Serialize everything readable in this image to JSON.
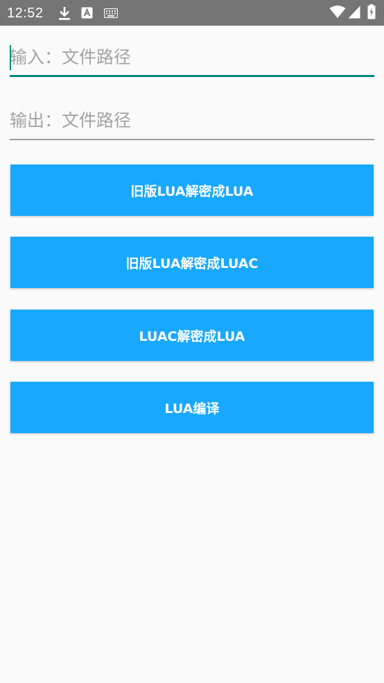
{
  "status_bar": {
    "time": "12:52",
    "left_icons": [
      "download-icon",
      "a-notification-icon",
      "keyboard-icon"
    ],
    "right_icons": [
      "wifi-icon",
      "signal-icon",
      "battery-icon"
    ],
    "background": "#757575"
  },
  "input_field": {
    "placeholder": "输入：文件路径",
    "value": "",
    "focused": true,
    "accent": "#00897b"
  },
  "output_field": {
    "placeholder": "输出：文件路径",
    "value": ""
  },
  "buttons": [
    {
      "label": "旧版LUA解密成LUA"
    },
    {
      "label": "旧版LUA解密成LUAC"
    },
    {
      "label": "LUAC解密成LUA"
    },
    {
      "label": "LUA编译"
    }
  ],
  "colors": {
    "button": "#18a8ff",
    "button_text": "#ffffff",
    "background": "#fafafa"
  }
}
